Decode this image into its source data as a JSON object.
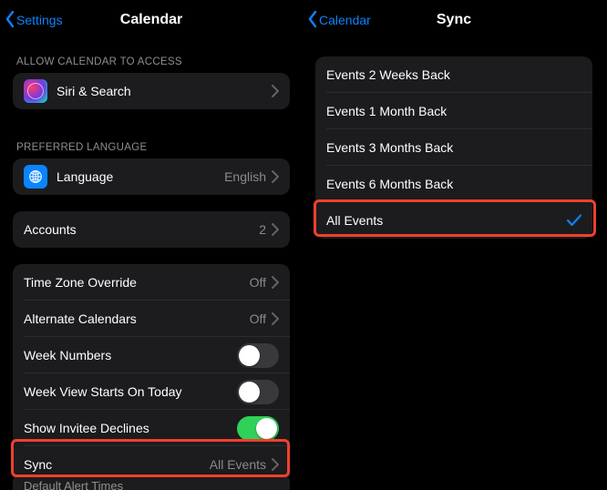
{
  "left": {
    "back_label": "Settings",
    "title": "Calendar",
    "section_access": "ALLOW CALENDAR TO ACCESS",
    "siri_label": "Siri & Search",
    "section_lang": "PREFERRED LANGUAGE",
    "language_label": "Language",
    "language_value": "English",
    "accounts_label": "Accounts",
    "accounts_value": "2",
    "tzo_label": "Time Zone Override",
    "tzo_value": "Off",
    "altcal_label": "Alternate Calendars",
    "altcal_value": "Off",
    "weeknum_label": "Week Numbers",
    "weekstart_label": "Week View Starts On Today",
    "invitee_label": "Show Invitee Declines",
    "sync_label": "Sync",
    "sync_value": "All Events",
    "cut_label": "Default Alert Times"
  },
  "right": {
    "back_label": "Calendar",
    "title": "Sync",
    "options": [
      {
        "label": "Events 2 Weeks Back",
        "selected": false
      },
      {
        "label": "Events 1 Month Back",
        "selected": false
      },
      {
        "label": "Events 3 Months Back",
        "selected": false
      },
      {
        "label": "Events 6 Months Back",
        "selected": false
      },
      {
        "label": "All Events",
        "selected": true
      }
    ]
  }
}
